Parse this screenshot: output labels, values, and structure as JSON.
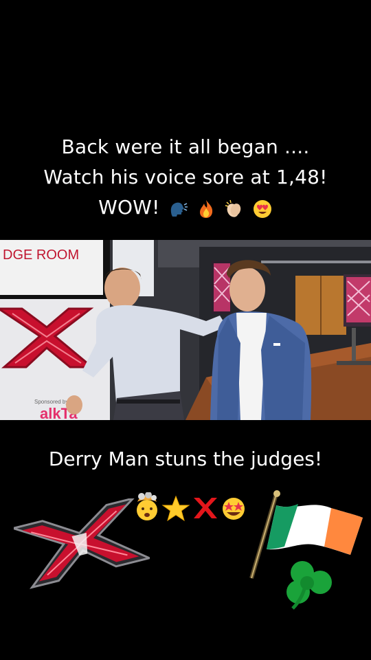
{
  "caption_top": {
    "line1": "Back were it all began ....",
    "line2": "Watch his voice sore at 1,48!",
    "line3": "WOW!",
    "emojis": [
      "speaking-head-icon",
      "fire-icon",
      "clapping-hands-icon",
      "heart-eyes-icon"
    ]
  },
  "video": {
    "door_sign": "DGE ROOM",
    "sponsor_text": "Sponsored by",
    "board_text": "alkTa"
  },
  "caption_bottom": {
    "text": "Derry Man stuns the judges!",
    "emojis": [
      "exploding-head-icon",
      "star-icon",
      "cross-mark-icon",
      "star-struck-icon"
    ]
  },
  "colors": {
    "background": "#000000",
    "text": "#ffffff",
    "xfactor_red": "#c8102e",
    "flag_green": "#169b62",
    "flag_orange": "#ff883e"
  }
}
